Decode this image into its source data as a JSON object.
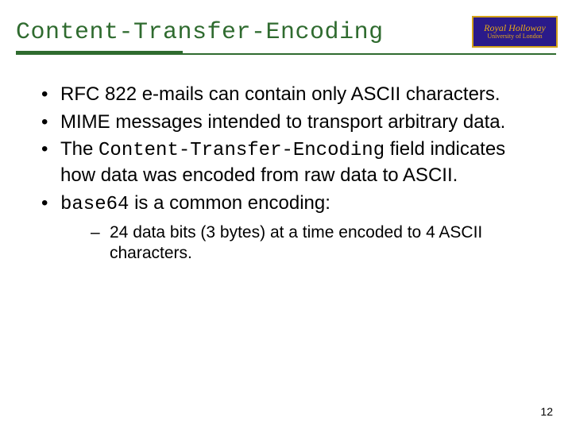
{
  "title": "Content-Transfer-Encoding",
  "logo": {
    "line1": "Royal Holloway",
    "line2": "University of London"
  },
  "bullets": {
    "b1_pre": "RFC 822 e-mails can contain only ASCII characters.",
    "b2": "MIME messages intended to transport arbitrary data.",
    "b3_pre": "The ",
    "b3_code": "Content-Transfer-Encoding",
    "b3_post": " field indicates how data was encoded from raw data to ASCII.",
    "b4_code": "base64",
    "b4_post": " is a common encoding:"
  },
  "sub": {
    "s1": "24 data bits (3 bytes) at a time encoded to 4 ASCII characters."
  },
  "page_number": "12"
}
